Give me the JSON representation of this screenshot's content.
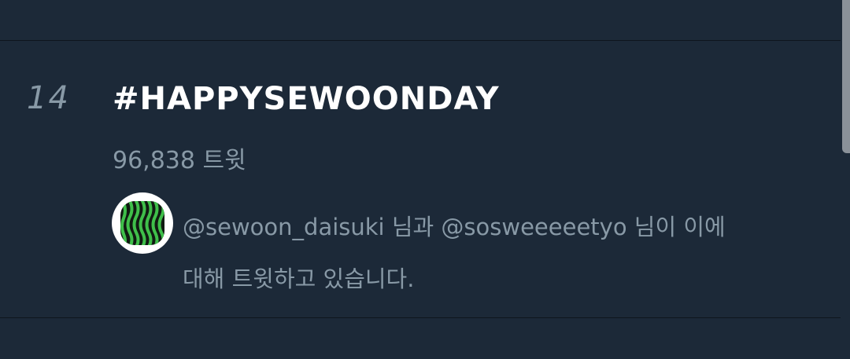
{
  "trend": {
    "rank": "14",
    "hashtag": "#HAPPYSEWOONDAY",
    "tweet_count": "96,838 트윗",
    "context_line1": "@sewoon_daisuki 님과 @sosweeeeetyo 님이 이에",
    "context_line2": "대해 트윗하고 있습니다."
  },
  "colors": {
    "background": "#1c2938",
    "divider": "#0e151d",
    "primary_text": "#ffffff",
    "secondary_text": "#8899a6",
    "avatar_green": "#3fbf4a"
  },
  "icons": {
    "avatar": "watermelon-pattern-avatar"
  }
}
